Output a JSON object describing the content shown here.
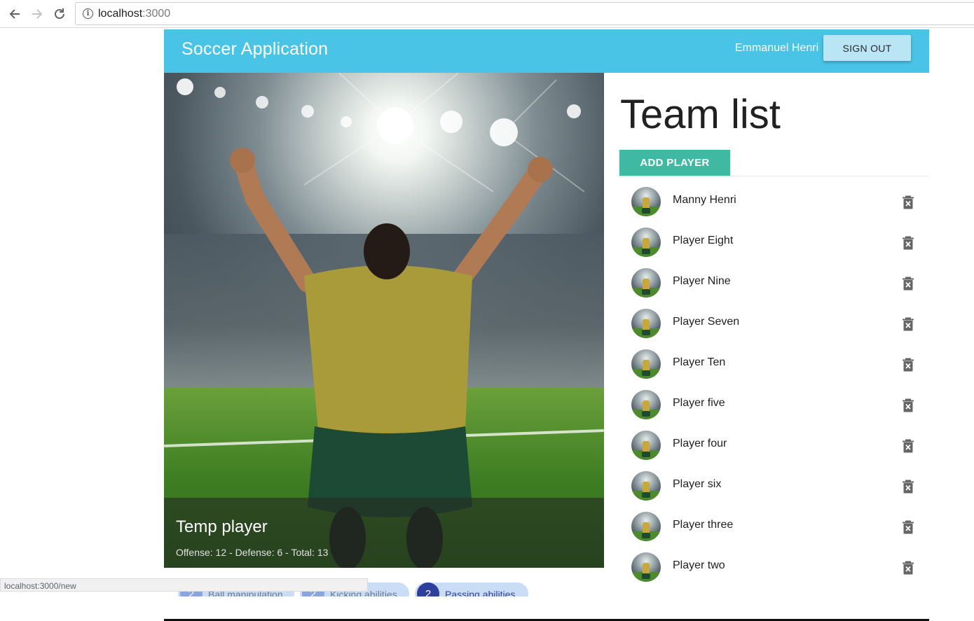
{
  "browser": {
    "url_host": "localhost",
    "url_port": ":3000",
    "status_url": "localhost:3000/new"
  },
  "appbar": {
    "title": "Soccer Application",
    "user_name": "Emmanuel Henri",
    "signout_label": "SIGN OUT"
  },
  "hero": {
    "title": "Temp player",
    "subtitle": "Offense: 12 - Defense: 6 - Total: 13"
  },
  "chips": [
    {
      "avatar": "2",
      "label": "Ball manipulation"
    },
    {
      "avatar": "2",
      "label": "Kicking abilities"
    },
    {
      "avatar": "2",
      "label": "Passing abilities"
    }
  ],
  "team": {
    "title": "Team list",
    "add_label": "ADD PLAYER",
    "players": [
      {
        "name": "Manny Henri"
      },
      {
        "name": "Player Eight"
      },
      {
        "name": "Player Nine"
      },
      {
        "name": "Player Seven"
      },
      {
        "name": "Player Ten"
      },
      {
        "name": "Player five"
      },
      {
        "name": "Player four"
      },
      {
        "name": "Player six"
      },
      {
        "name": "Player three"
      },
      {
        "name": "Player two"
      }
    ]
  },
  "colors": {
    "appbar": "#49c3e6",
    "signout_button": "#b9e5f4",
    "add_button": "#3fb9a1"
  },
  "icons": {
    "back": "arrow-left-icon",
    "forward": "arrow-right-icon",
    "reload": "reload-icon",
    "site_info": "info-icon",
    "delete": "delete-forever-icon"
  }
}
